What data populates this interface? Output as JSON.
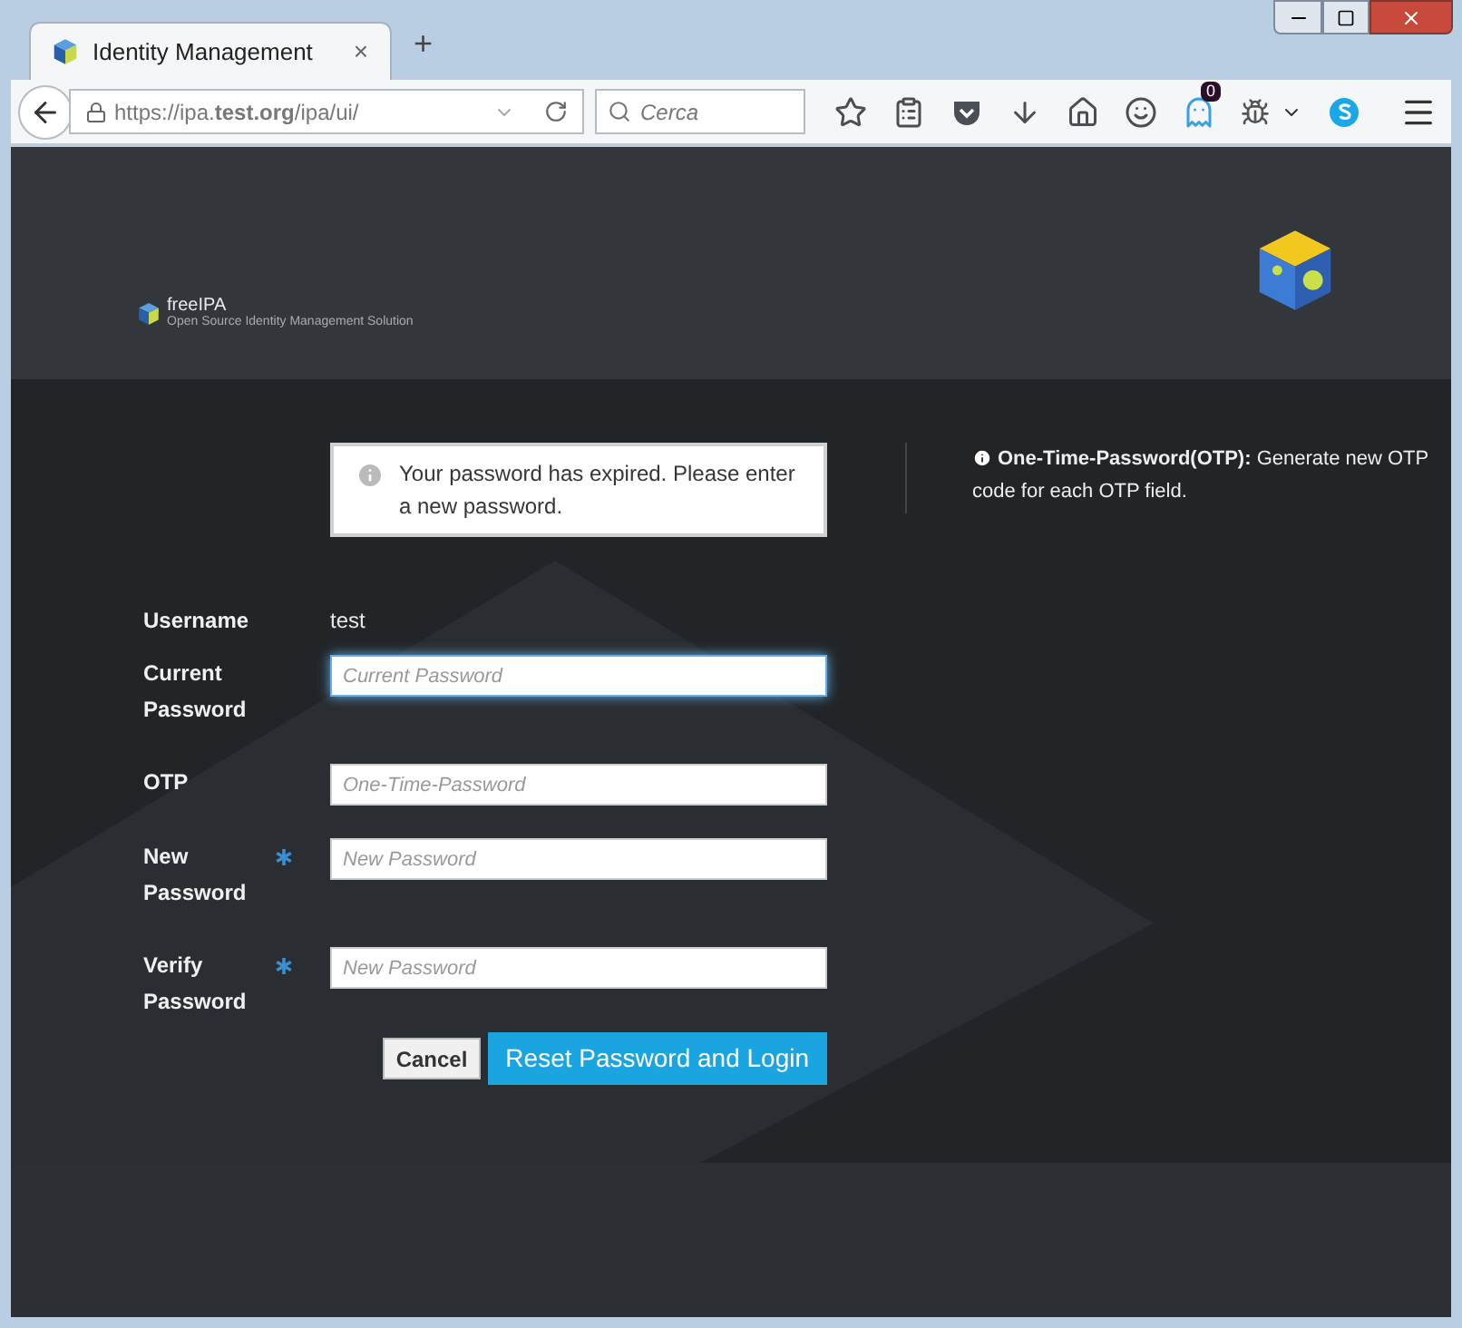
{
  "browser": {
    "tab": {
      "title": "Identity Management",
      "close": "×"
    },
    "new_tab": "+",
    "url": "https://ipa.**test.org**/ipa/ui/",
    "search": {
      "placeholder": "Cerca"
    },
    "badge": "0"
  },
  "header": {
    "logo": "freeIPA",
    "tagline": "Open Source Identity Management Solution"
  },
  "alert": {
    "text": "Your password has expired. Please enter a new password."
  },
  "info": {
    "title": "One-Time-Password(OTP):",
    "text": "Generate new OTP code for each OTP field."
  },
  "form": {
    "rows": [
      {
        "kind": "text",
        "label": "Username",
        "value": "test",
        "required": false
      },
      {
        "kind": "input",
        "label": "Current Password",
        "placeholder": "Current Password",
        "required": false,
        "focused": true
      },
      {
        "kind": "input",
        "label": "OTP",
        "placeholder": "One-Time-Password",
        "required": false,
        "focused": false
      },
      {
        "kind": "input",
        "label": "New Password",
        "placeholder": "New Password",
        "required": true,
        "focused": false
      },
      {
        "kind": "input",
        "label": "Verify Password",
        "placeholder": "New Password",
        "required": true,
        "focused": false
      }
    ]
  },
  "buttons": [
    {
      "kind": "secondary",
      "label": "Cancel"
    },
    {
      "kind": "primary",
      "label": "Reset Password and Login"
    }
  ]
}
